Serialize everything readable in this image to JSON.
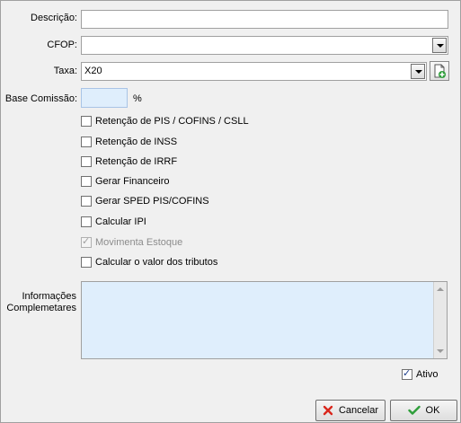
{
  "form": {
    "descricao_label": "Descrição:",
    "descricao_value": "",
    "cfop_label": "CFOP:",
    "cfop_value": "",
    "taxa_label": "Taxa:",
    "taxa_value": "X20",
    "base_comissao_label": "Base Comissão:",
    "base_comissao_value": "",
    "percent_symbol": "%"
  },
  "checkboxes": [
    {
      "label": "Retenção de PIS / COFINS / CSLL",
      "checked": false,
      "disabled": false
    },
    {
      "label": "Retenção de INSS",
      "checked": false,
      "disabled": false
    },
    {
      "label": "Retenção de IRRF",
      "checked": false,
      "disabled": false
    },
    {
      "label": "Gerar Financeiro",
      "checked": false,
      "disabled": false
    },
    {
      "label": "Gerar SPED PIS/COFINS",
      "checked": false,
      "disabled": false
    },
    {
      "label": "Calcular IPI",
      "checked": false,
      "disabled": false
    },
    {
      "label": "Movimenta Estoque",
      "checked": true,
      "disabled": true
    },
    {
      "label": "Calcular o valor dos tributos",
      "checked": false,
      "disabled": false
    }
  ],
  "informacoes": {
    "label_line1": "Informações",
    "label_line2": "Complemetares",
    "value": ""
  },
  "ativo": {
    "label": "Ativo",
    "checked": true
  },
  "buttons": {
    "cancel_label": "Cancelar",
    "ok_label": "OK"
  },
  "colors": {
    "cancel_icon": "#d9261c",
    "ok_icon": "#2e9e3a",
    "textarea_bg": "#dfeefc",
    "input_border": "#7a9cc6"
  }
}
